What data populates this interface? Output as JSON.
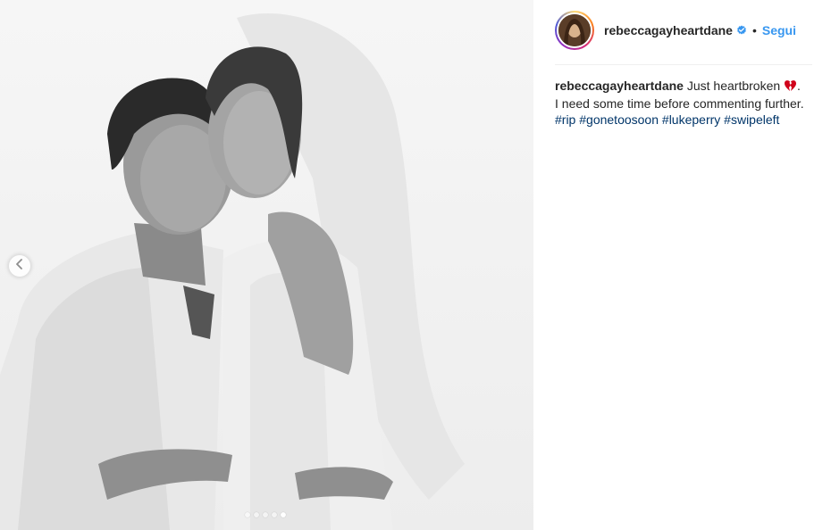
{
  "post": {
    "carousel": {
      "slide_count": 5,
      "active_slide": 5
    }
  },
  "profile": {
    "username": "rebeccagayheartdane",
    "verified": true,
    "separator": "•",
    "follow_label": "Segui"
  },
  "caption": {
    "username": "rebeccagayheartdane",
    "text_1": " Just heartbroken ",
    "emoji": "💔",
    "text_2": ". I need some time before commenting further. ",
    "hashtags": [
      "#rip",
      "#gonetoosoon",
      "#lukeperry",
      "#swipeleft"
    ]
  },
  "colors": {
    "link_blue": "#3897f0",
    "hashtag": "#003569",
    "verified_badge": "#3897f0",
    "heart": "#d0021b"
  },
  "icons": {
    "prev": "chevron-left-icon",
    "verified": "verified-badge-icon",
    "emoji": "broken-heart-icon"
  }
}
